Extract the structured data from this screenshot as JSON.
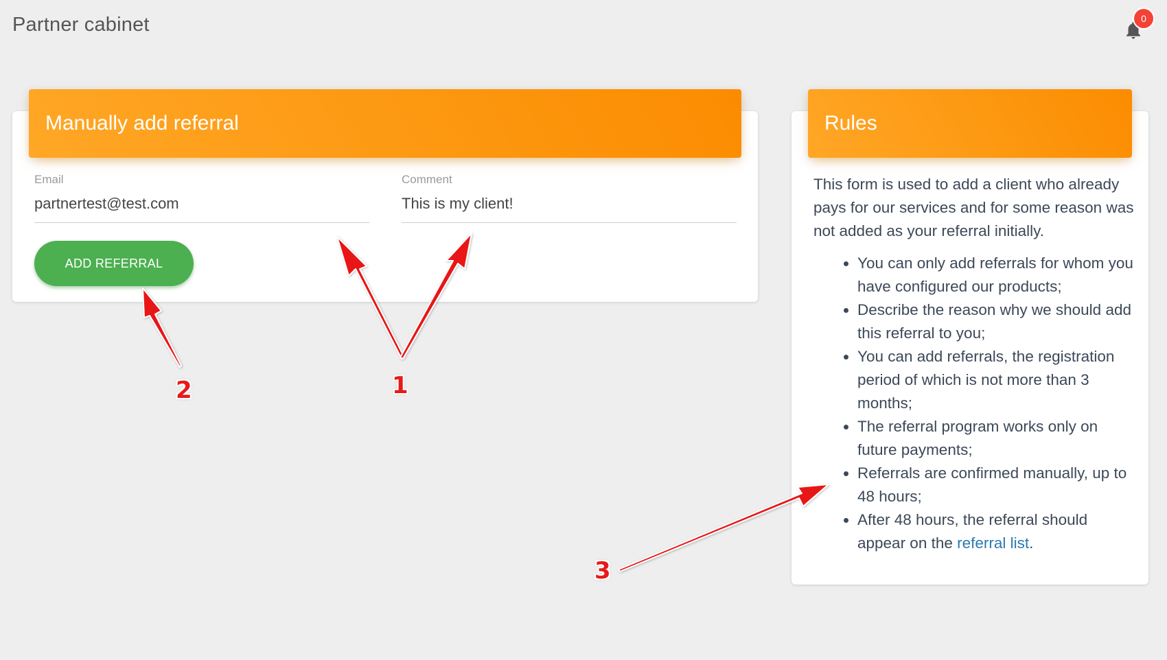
{
  "header": {
    "title": "Partner cabinet",
    "notification_count": "0"
  },
  "add_referral": {
    "title": "Manually add referral",
    "email": {
      "label": "Email",
      "value": "partnertest@test.com"
    },
    "comment": {
      "label": "Comment",
      "value": "This is my client!"
    },
    "submit_label": "ADD REFERRAL"
  },
  "rules": {
    "title": "Rules",
    "intro": "This form is used to add a client who already pays for our services and for some reason was not added as your referral initially.",
    "items": [
      "You can only add referrals for whom you have configured our products;",
      "Describe the reason why we should add this referral to you;",
      "You can add referrals, the registration period of which is not more than 3 months;",
      "The referral program works only on future payments;",
      "Referrals are confirmed manually, up to 48 hours;"
    ],
    "last_item_prefix": "After 48 hours, the referral should appear on the ",
    "last_item_link": "referral list",
    "last_item_suffix": "."
  },
  "annotations": {
    "label_1": "1",
    "label_2": "2",
    "label_3": "3",
    "color": "#e81919"
  },
  "colors": {
    "header_orange_start": "#ffa726",
    "header_orange_end": "#fb8c00",
    "button_green": "#4caf50",
    "badge_red": "#f44336",
    "link_blue": "#2a7ab0"
  }
}
